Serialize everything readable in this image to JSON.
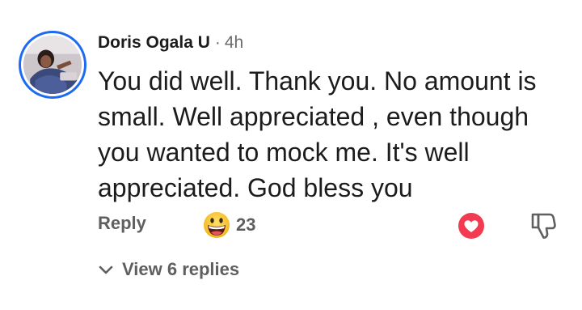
{
  "comment": {
    "author": "Doris Ogala U",
    "separator": "·",
    "time": "4h",
    "text": "You did well. Thank you. No amount is\nsmall. Well appreciated , even though\nyou wanted to mock me. It's well\nappreciated. God bless you",
    "avatar_icon": "profile-photo"
  },
  "actions": {
    "reply_label": "Reply",
    "reaction_icon": "grinning-face-emoji",
    "reaction_count": "23",
    "like_icon": "heart-icon",
    "dislike_icon": "thumbs-down-icon"
  },
  "replies": {
    "label": "View 6 replies",
    "icon": "chevron-down-icon"
  },
  "colors": {
    "avatar_ring": "#1d6bf3",
    "heart": "#f23a50",
    "muted_text": "#5f5f5f",
    "emoji_face": "#f7c321"
  }
}
